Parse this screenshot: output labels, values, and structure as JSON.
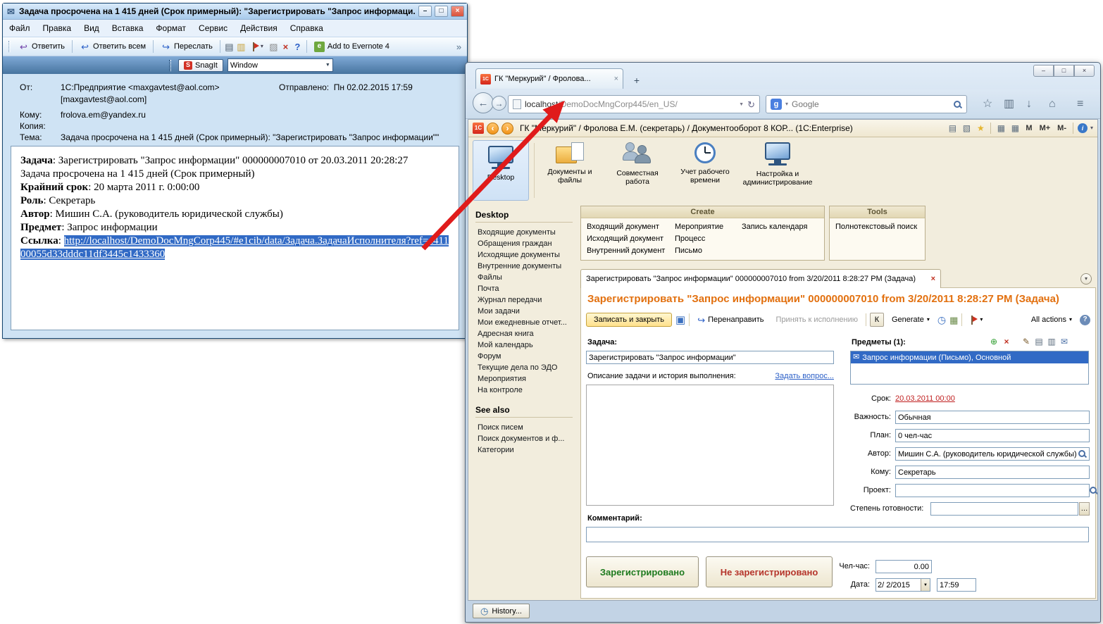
{
  "colors": {
    "accent_orange": "#E2700F",
    "selection_blue": "#316AC5",
    "registered_green": "#1E7A1E",
    "not_registered_red": "#B5342A",
    "overdue_red": "#C02020",
    "arrow_red": "#E01B1B"
  },
  "email": {
    "window_title": "Задача просрочена на 1 415 дней (Срок примерный): \"Зарегистрировать \"Запрос информаци...",
    "menu": [
      "Файл",
      "Правка",
      "Вид",
      "Вставка",
      "Формат",
      "Сервис",
      "Действия",
      "Справка"
    ],
    "toolbar": {
      "reply": "Ответить",
      "reply_all": "Ответить всем",
      "forward": "Переслать",
      "evernote": "Add to Evernote 4"
    },
    "snagit": {
      "button": "SnagIt",
      "mode": "Window"
    },
    "headers": {
      "from_label": "От:",
      "from_value": "1С:Предприятие <maxgavtest@aol.com>",
      "from_value2": "[maxgavtest@aol.com]",
      "sent_label": "Отправлено:",
      "sent_value": "Пн 02.02.2015 17:59",
      "to_label": "Кому:",
      "to_value": "frolova.em@yandex.ru",
      "cc_label": "Копия:",
      "subject_label": "Тема:",
      "subject_value": "Задача просрочена на 1 415 дней (Срок примерный): \"Зарегистрировать \"Запрос информации\"\""
    },
    "body": {
      "l1_label": "Задача",
      "l1_text": ": Зарегистрировать \"Запрос информации\" 000000007010 от 20.03.2011 20:28:27",
      "l2_text": "Задача просрочена на 1 415 дней (Срок примерный)",
      "l3_label": "Крайний срок",
      "l3_text": ": 20 марта 2011 г. 0:00:00",
      "l4_label": "Роль",
      "l4_text": ": Секретарь",
      "l5_label": "Автор",
      "l5_text": ": Мишин С.А. (руководитель юридической службы)",
      "l6_label": "Предмет",
      "l6_text": ": Запрос информации",
      "l7_label": "Ссылка",
      "l7_text": ": ",
      "link": "http://localhost/DemoDocMngCorp445/#e1cib/data/Задача.ЗадачаИсполнителя?ref=a41100055d33dddc11df3445c1433360"
    }
  },
  "browser": {
    "tab_title": "ГК \"Меркурий\" / Фролова...",
    "url_host": "localhost",
    "url_path": "/DemoDocMngCorp445/en_US/",
    "search_placeholder": "Google"
  },
  "app": {
    "titlebar": "ГК \"Меркурий\" / Фролова Е.М. (секретарь) / Документооборот 8 КОР... (1С:Enterprise)",
    "m_buttons": [
      "M",
      "M+",
      "M-"
    ],
    "desktop_tile": "Desktop",
    "sections": [
      "Документы и файлы",
      "Совместная работа",
      "Учет рабочего времени",
      "Настройка и администрирование"
    ],
    "create": {
      "title": "Create",
      "col1": [
        "Входящий документ",
        "Исходящий документ",
        "Внутренний документ"
      ],
      "col2": [
        "Мероприятие",
        "Процесс",
        "Письмо"
      ],
      "col3": [
        "Запись календаря"
      ]
    },
    "tools": {
      "title": "Tools",
      "item": "Полнотекстовый поиск"
    },
    "sidebar": {
      "header": "Desktop",
      "items": [
        "Входящие документы",
        "Обращения граждан",
        "Исходящие документы",
        "Внутренние документы",
        "Файлы",
        "Почта",
        "Журнал передачи",
        "Мои задачи",
        "Мои ежедневные отчет...",
        "Адресная книга",
        "Мой календарь",
        "Форум",
        "Текущие дела по ЭДО",
        "Мероприятия",
        "На контроле"
      ],
      "see_also": "See also",
      "see_items": [
        "Поиск писем",
        "Поиск документов и ф...",
        "Категории"
      ]
    },
    "doc_tab": "Зарегистрировать \"Запрос информации\" 000000007010 from 3/20/2011 8:28:27 PM (Задача)",
    "page_title": "Зарегистрировать \"Запрос информации\" 000000007010 from 3/20/2011 8:28:27 PM (Задача)",
    "cmd": {
      "save_close": "Записать и закрыть",
      "redirect": "Перенаправить",
      "accept": "Принять к исполнению",
      "k": "К",
      "generate": "Generate",
      "all_actions": "All actions"
    },
    "form": {
      "task_label": "Задача:",
      "task_value": "Зарегистрировать \"Запрос информации\"",
      "desc_label": "Описание задачи и история выполнения:",
      "ask_link": "Задать вопрос...",
      "comment_label": "Комментарий:",
      "btn_registered": "Зарегистрировано",
      "btn_not_registered": "Не зарегистрировано",
      "subjects_label": "Предметы (1):",
      "subject_item": "Запрос информации (Письмо), Основной",
      "due_label": "Срок:",
      "due_value": "20.03.2011 00:00",
      "importance_label": "Важность:",
      "importance_value": "Обычная",
      "plan_label": "План:",
      "plan_value": "0 чел-час",
      "author_label": "Автор:",
      "author_value": "Мишин С.А. (руководитель юридической службы)",
      "to_label": "Кому:",
      "to_value": "Секретарь",
      "project_label": "Проект:",
      "readiness_label": "Степень готовности:",
      "manhours_label": "Чел-час:",
      "manhours_value": "0.00",
      "date_label": "Дата:",
      "date_value": "2/ 2/2015",
      "time_value": "17:59"
    },
    "history": "History..."
  }
}
